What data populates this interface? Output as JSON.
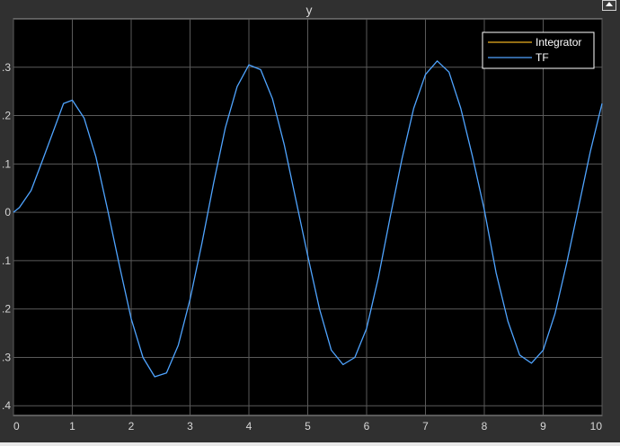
{
  "scope": {
    "title": "y",
    "colors": {
      "axes_background": "#000000",
      "figure_background": "#303030",
      "grid": "#5a5a5a",
      "tick_text": "#d6d6d6",
      "legend_background": "#ffffff",
      "legend_text": "#ffffff"
    },
    "undock_icon": "undock-arrow-icon"
  },
  "chart_data": {
    "type": "line",
    "title": "y",
    "xlabel": "",
    "ylabel": "",
    "xlim": [
      0,
      10
    ],
    "ylim": [
      -0.42,
      0.4
    ],
    "xticks": [
      "0",
      "1",
      "2",
      "3",
      "4",
      "5",
      "6",
      "7",
      "8",
      "9",
      "10"
    ],
    "yticks": [
      {
        "value": 0.3,
        "label": ".3"
      },
      {
        "value": 0.2,
        "label": ".2"
      },
      {
        "value": 0.1,
        "label": ".1"
      },
      {
        "value": 0.0,
        "label": "0"
      },
      {
        "value": -0.1,
        "label": ".1"
      },
      {
        "value": -0.2,
        "label": ".2"
      },
      {
        "value": -0.3,
        "label": ".3"
      },
      {
        "value": -0.4,
        "label": ".4"
      }
    ],
    "grid": true,
    "legend": "top-right",
    "series": [
      {
        "name": "Integrator",
        "color": "#edb120",
        "x": [
          0,
          10
        ],
        "y": [
          0,
          0
        ],
        "visible": false
      },
      {
        "name": "TF",
        "color": "#4fa4ff",
        "x": [
          0,
          0.1,
          0.3,
          0.5,
          0.7,
          0.85,
          1.0,
          1.2,
          1.4,
          1.6,
          1.8,
          2.0,
          2.2,
          2.4,
          2.6,
          2.8,
          3.0,
          3.2,
          3.4,
          3.6,
          3.8,
          4.0,
          4.2,
          4.4,
          4.6,
          4.8,
          5.0,
          5.2,
          5.4,
          5.6,
          5.8,
          6.0,
          6.2,
          6.4,
          6.6,
          6.8,
          7.0,
          7.2,
          7.4,
          7.6,
          7.8,
          8.0,
          8.2,
          8.4,
          8.6,
          8.8,
          9.0,
          9.2,
          9.4,
          9.6,
          9.8,
          10.0
        ],
        "y": [
          0,
          0.01,
          0.045,
          0.11,
          0.175,
          0.225,
          0.232,
          0.195,
          0.115,
          0.005,
          -0.11,
          -0.22,
          -0.3,
          -0.34,
          -0.332,
          -0.275,
          -0.18,
          -0.065,
          0.06,
          0.175,
          0.26,
          0.305,
          0.295,
          0.235,
          0.14,
          0.025,
          -0.09,
          -0.2,
          -0.285,
          -0.315,
          -0.3,
          -0.24,
          -0.135,
          -0.01,
          0.11,
          0.215,
          0.285,
          0.313,
          0.29,
          0.215,
          0.115,
          0.005,
          -0.125,
          -0.225,
          -0.295,
          -0.312,
          -0.285,
          -0.21,
          -0.105,
          0.01,
          0.125,
          0.225
        ]
      }
    ]
  }
}
